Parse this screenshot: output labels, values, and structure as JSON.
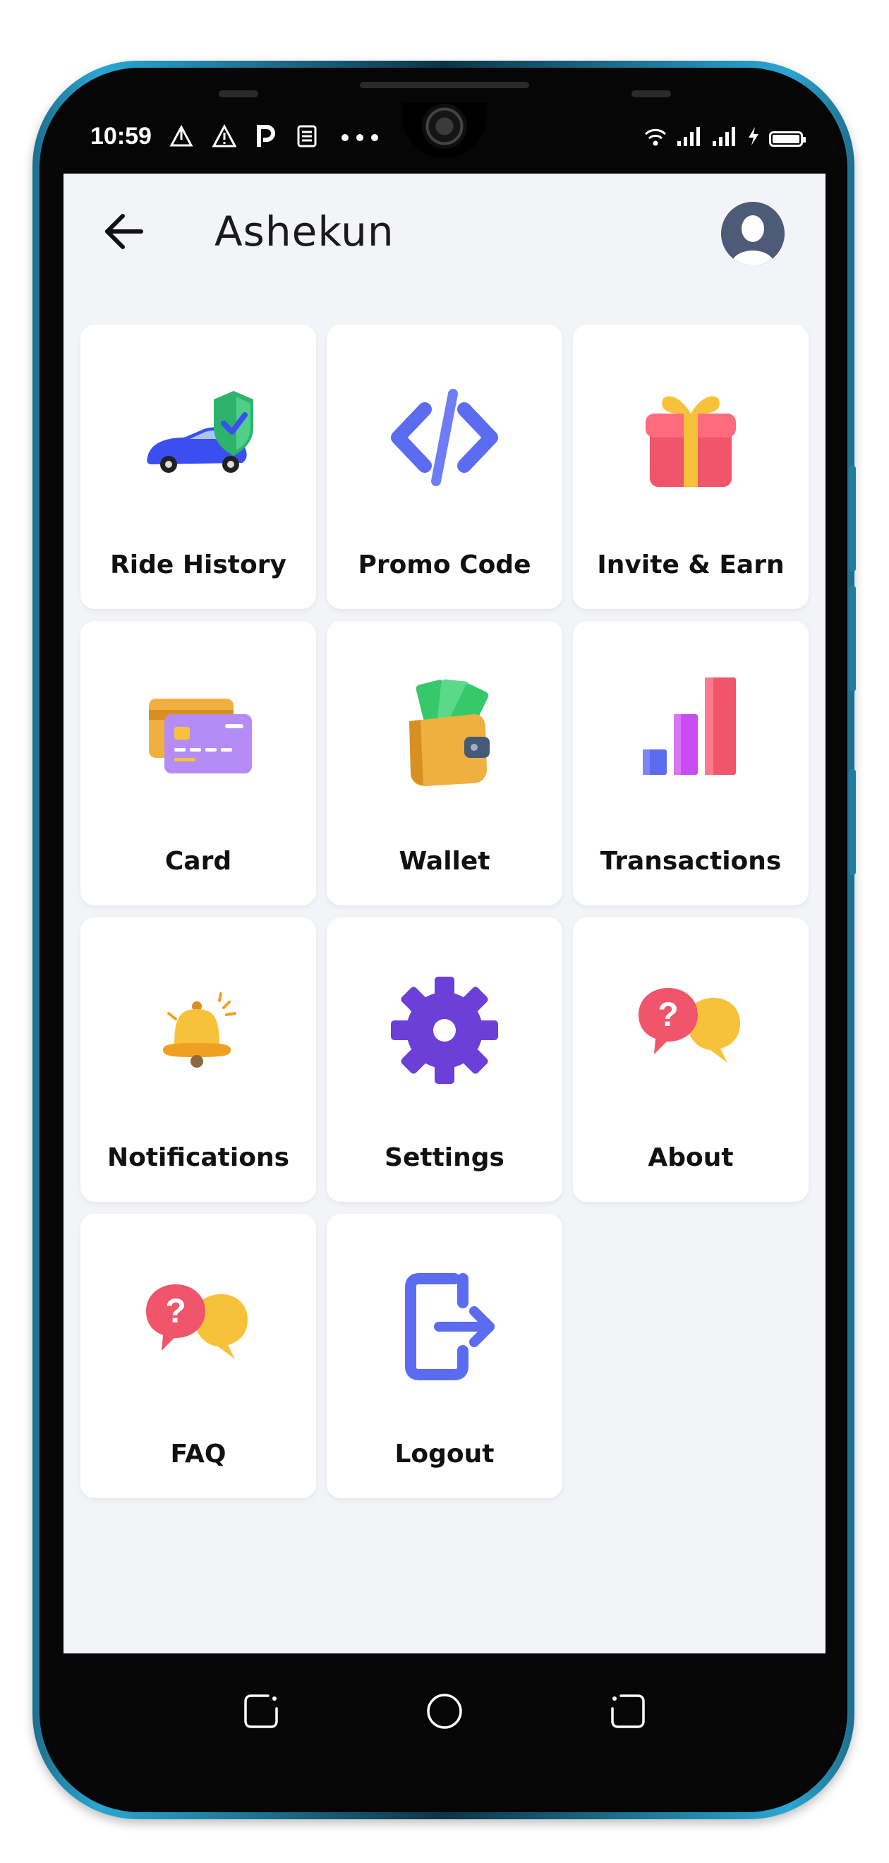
{
  "status_bar": {
    "time": "10:59",
    "left_icons": [
      "navigation-icon",
      "warning-icon",
      "parking-icon",
      "news-icon",
      "more-dots-icon"
    ],
    "right_icons": [
      "wifi-icon",
      "signal-icon",
      "signal-icon",
      "charging-icon",
      "battery-icon"
    ]
  },
  "header": {
    "title": "Ashekun",
    "back_icon": "arrow-left-icon",
    "avatar_icon": "user-avatar-icon"
  },
  "menu": {
    "items": [
      {
        "label": "Ride History",
        "icon": "car-shield-icon"
      },
      {
        "label": "Promo Code",
        "icon": "code-icon"
      },
      {
        "label": "Invite & Earn",
        "icon": "gift-icon"
      },
      {
        "label": "Card",
        "icon": "credit-card-icon"
      },
      {
        "label": "Wallet",
        "icon": "wallet-icon"
      },
      {
        "label": "Transactions",
        "icon": "bar-chart-icon"
      },
      {
        "label": "Notifications",
        "icon": "bell-icon"
      },
      {
        "label": "Settings",
        "icon": "gear-icon"
      },
      {
        "label": "About",
        "icon": "question-bubbles-icon"
      },
      {
        "label": "FAQ",
        "icon": "question-bubbles-icon"
      },
      {
        "label": "Logout",
        "icon": "logout-icon"
      }
    ]
  },
  "nav_bar": {
    "items": [
      "recent-apps-icon",
      "home-icon",
      "back-icon"
    ]
  },
  "colors": {
    "background": "#f3f4f8",
    "tile": "#ffffff",
    "accent_blue": "#5b6cf0",
    "accent_purple": "#6b3fd8",
    "accent_red": "#f0556b",
    "accent_yellow": "#f7c23a"
  }
}
